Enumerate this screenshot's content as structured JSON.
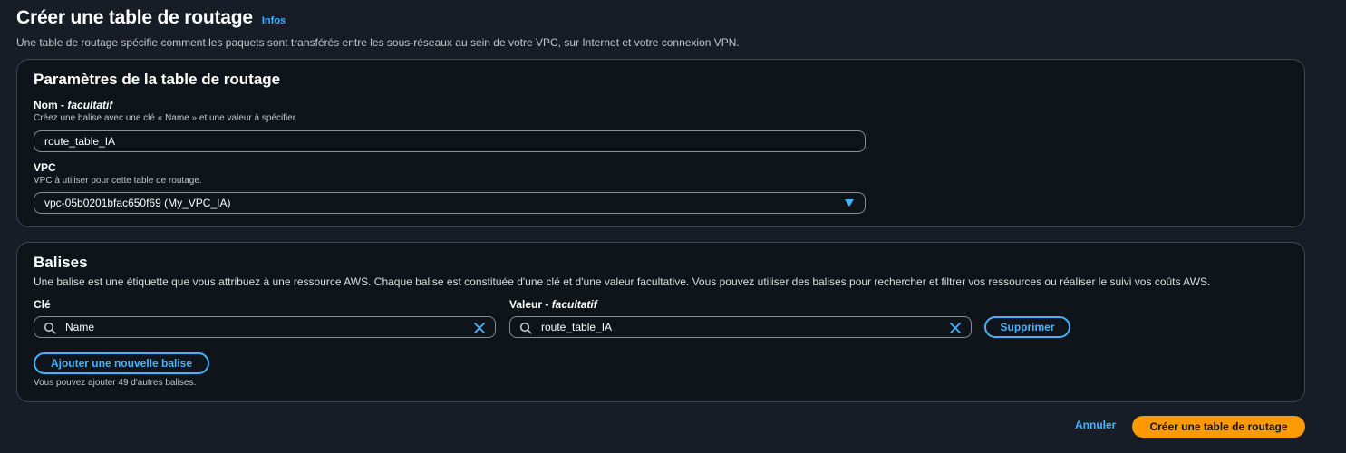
{
  "header": {
    "title": "Créer une table de routage",
    "info_link": "Infos",
    "description": "Une table de routage spécifie comment les paquets sont transférés entre les sous-réseaux au sein de votre VPC, sur Internet et votre connexion VPN."
  },
  "params": {
    "title": "Paramètres de la table de routage",
    "name_label": "Nom - ",
    "name_optional": "facultatif",
    "name_hint": "Créez une balise avec une clé « Name » et une valeur à spécifier.",
    "name_value": "route_table_IA",
    "vpc_label": "VPC",
    "vpc_hint": "VPC à utiliser pour cette table de routage.",
    "vpc_value": "vpc-05b0201bfac650f69 (My_VPC_IA)"
  },
  "tags": {
    "title": "Balises",
    "description": "Une balise est une étiquette que vous attribuez à une ressource AWS. Chaque balise est constituée d'une clé et d'une valeur facultative. Vous pouvez utiliser des balises pour rechercher et filtrer vos ressources ou réaliser le suivi vos coûts AWS.",
    "key_label": "Clé",
    "value_label": "Valeur - ",
    "value_optional": "facultatif",
    "key_value": "Name",
    "value_value": "route_table_IA",
    "remove_button": "Supprimer",
    "add_button": "Ajouter une nouvelle balise",
    "remaining_hint": "Vous pouvez ajouter 49 d'autres balises."
  },
  "footer": {
    "cancel": "Annuler",
    "submit": "Créer une table de routage"
  },
  "colors": {
    "background": "#161d26",
    "card": "#0f141a",
    "accent_link": "#42b4ff",
    "primary_button": "#ff9900"
  },
  "icons": [
    "search-icon",
    "clear-icon",
    "caret-down-icon"
  ]
}
